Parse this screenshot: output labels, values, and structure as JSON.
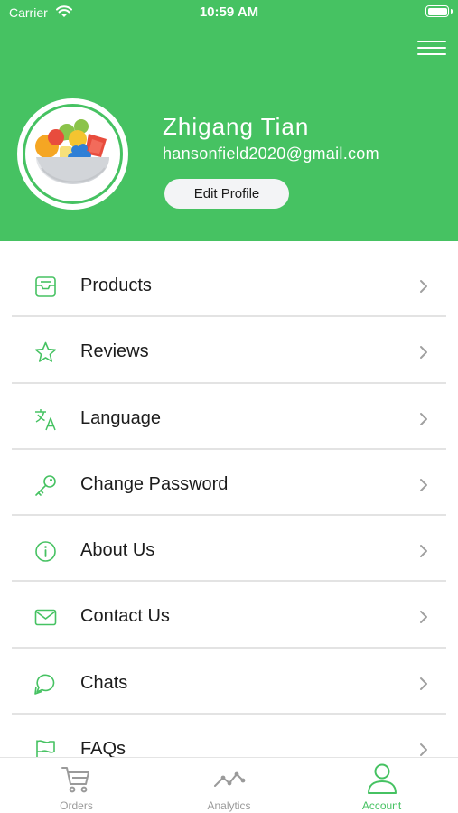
{
  "status_bar": {
    "carrier": "Carrier",
    "time": "10:59 AM"
  },
  "header": {
    "background_color": "#46c262",
    "menu_icon": "hamburger-icon",
    "avatar_icon": "fruit-bowl-icon"
  },
  "profile": {
    "name": "Zhigang Tian",
    "email": "hansonfield2020@gmail.com",
    "edit_label": "Edit Profile"
  },
  "menu": {
    "items": [
      {
        "label": "Products",
        "icon": "inbox-tray-icon"
      },
      {
        "label": "Reviews",
        "icon": "star-icon"
      },
      {
        "label": "Language",
        "icon": "translate-icon"
      },
      {
        "label": "Change Password",
        "icon": "key-icon"
      },
      {
        "label": "About Us",
        "icon": "info-icon"
      },
      {
        "label": "Contact Us",
        "icon": "mail-icon"
      },
      {
        "label": "Chats",
        "icon": "chat-bubble-icon"
      },
      {
        "label": "FAQs",
        "icon": "flag-icon"
      }
    ],
    "chevron_icon": "chevron-right-icon"
  },
  "tabbar": {
    "tabs": [
      {
        "label": "Orders",
        "icon": "cart-icon",
        "active": false
      },
      {
        "label": "Analytics",
        "icon": "line-chart-icon",
        "active": false
      },
      {
        "label": "Account",
        "icon": "user-icon",
        "active": true
      }
    ]
  },
  "colors": {
    "accent": "#46c262",
    "divider": "#e3e3e3",
    "inactive_tab": "#9a9a9a"
  }
}
